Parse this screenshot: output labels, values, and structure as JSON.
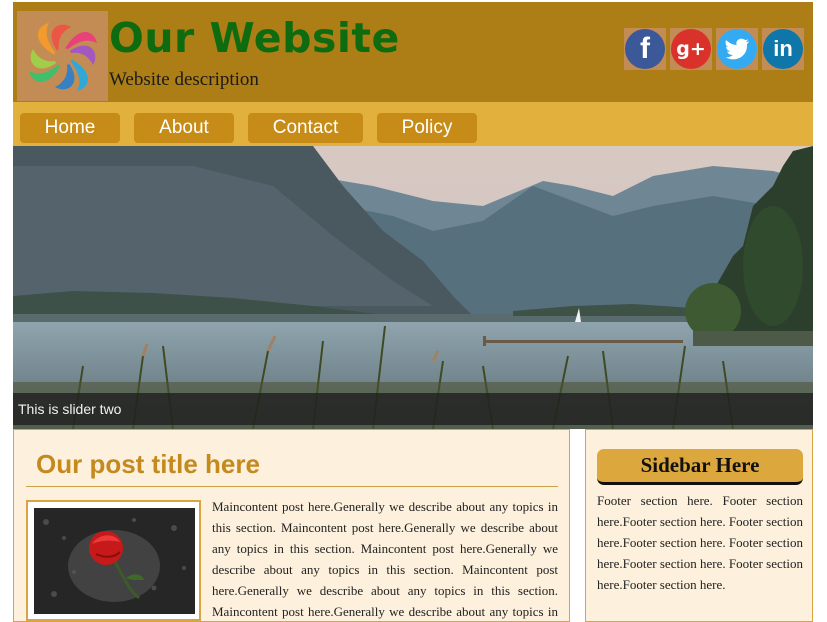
{
  "header": {
    "title": "Our Website",
    "description": "Website description",
    "logo_icon": "flower-swirl-logo",
    "social": [
      {
        "name": "facebook-icon",
        "glyph": "f",
        "color": "#3b5998"
      },
      {
        "name": "googleplus-icon",
        "glyph": "g+",
        "color": "#d9322b"
      },
      {
        "name": "twitter-icon",
        "glyph": "bird",
        "color": "#33aaf1"
      },
      {
        "name": "linkedin-icon",
        "glyph": "in",
        "color": "#0e76a8"
      }
    ]
  },
  "nav": {
    "items": [
      {
        "label": "Home"
      },
      {
        "label": "About"
      },
      {
        "label": "Contact"
      },
      {
        "label": "Policy"
      }
    ]
  },
  "slider": {
    "caption": "This is slider two"
  },
  "post": {
    "title": "Our post title here",
    "body": "Maincontent post here.Generally we describe about any topics in this section. Maincontent post here.Generally we describe about any topics in this section. Maincontent post here.Generally we describe about any topics in this section. Maincontent post here.Generally we describe about any topics in this section. Maincontent post here.Generally we describe about any topics in this section."
  },
  "sidebar": {
    "heading": "Sidebar Here",
    "body": "Footer section here. Footer section here.Footer section here. Footer section here.Footer section here. Footer section here.Footer section here. Footer section here.Footer section here."
  },
  "colors": {
    "header_bg": "#ad7e16",
    "nav_bg": "#e2b03c",
    "nav_button": "#c78c18",
    "title_green": "#0f6b0f",
    "post_title": "#c48a1e",
    "content_bg": "#fdf0dc"
  }
}
